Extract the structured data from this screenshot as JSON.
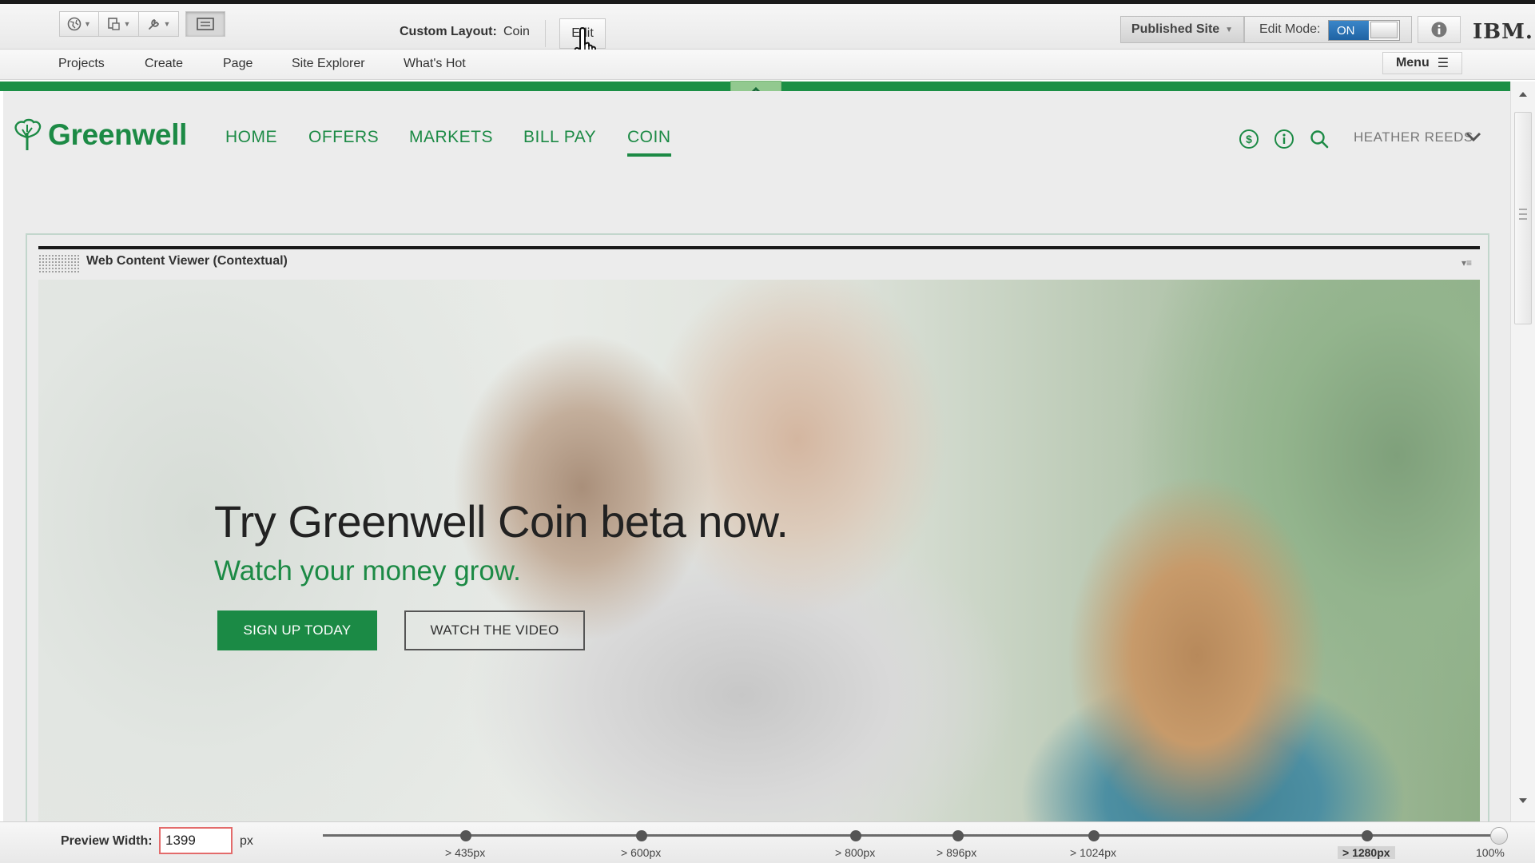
{
  "toolbar": {
    "custom_layout_label": "Custom Layout:",
    "custom_layout_value": "Coin",
    "edit_label": "Edit",
    "published_site_label": "Published Site",
    "edit_mode_label": "Edit Mode:",
    "edit_mode_state": "ON",
    "brand": "IBM."
  },
  "subnav": {
    "items": [
      "Projects",
      "Create",
      "Page",
      "Site Explorer",
      "What's Hot"
    ],
    "menu_label": "Menu"
  },
  "site": {
    "logo_text": "Greenwell",
    "nav": [
      "HOME",
      "OFFERS",
      "MARKETS",
      "BILL PAY",
      "COIN"
    ],
    "active_nav": "COIN",
    "user_name": "HEATHER REEDS"
  },
  "portlet": {
    "title": "Web Content Viewer (Contextual)"
  },
  "hero": {
    "headline": "Try Greenwell Coin beta now.",
    "subheadline": "Watch your money grow.",
    "primary_button": "SIGN UP TODAY",
    "secondary_button": "WATCH THE VIDEO"
  },
  "preview": {
    "label": "Preview Width:",
    "value": "1399",
    "unit": "px",
    "breakpoints": [
      "> 435px",
      "> 600px",
      "> 800px",
      "> 896px",
      "> 1024px",
      "> 1280px"
    ],
    "active_breakpoint": "> 1280px",
    "max_label": "100%"
  },
  "colors": {
    "brand_green": "#1c8a45",
    "toggle_blue": "#2a74b8",
    "input_border_red": "#e36b6b"
  },
  "icons": [
    "globe-icon",
    "page-icon",
    "wrench-icon",
    "panel-icon",
    "hand-cursor-icon",
    "info-icon",
    "menu-icon",
    "collapse-arrow-icon",
    "greenwell-tree-icon",
    "dollar-icon",
    "info-circle-icon",
    "search-icon",
    "chevron-down-icon"
  ]
}
